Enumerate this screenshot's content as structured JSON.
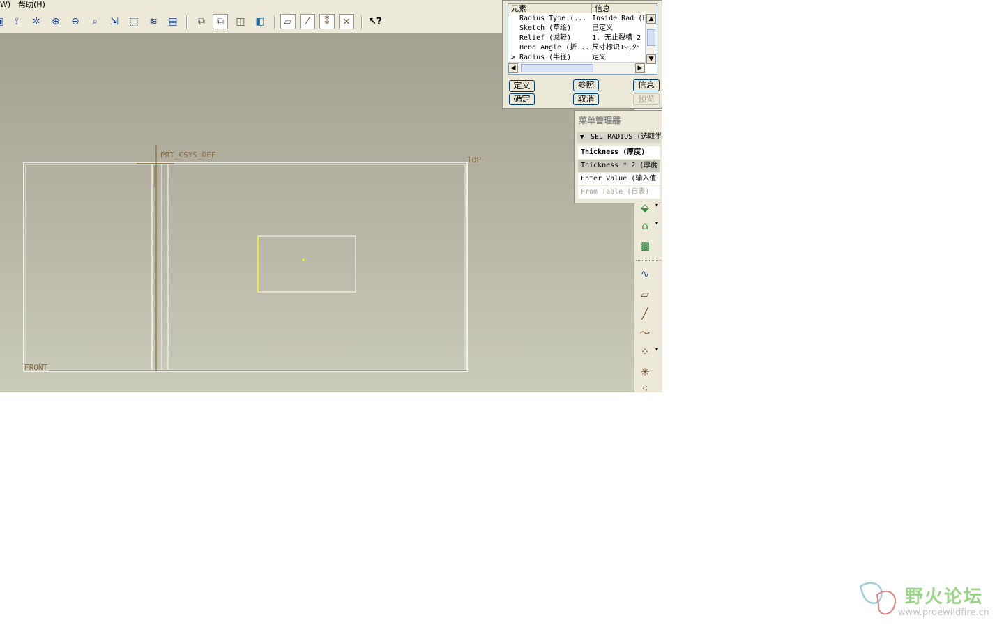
{
  "menubar": {
    "item_w_suffix": "W)",
    "help": "帮助(H)"
  },
  "toolbar": {
    "icons": [
      "repaint-icon",
      "csys-icon",
      "orient-icon",
      "zoom-in-icon",
      "zoom-out-icon",
      "refit-icon",
      "reorient-icon",
      "named-view-icon",
      "layers-icon",
      "view-manager-icon",
      "wireframe-icon",
      "hidden-line-icon",
      "no-hidden-icon",
      "shading-icon",
      "datum-planes-icon",
      "datum-axes-icon",
      "datum-points-icon",
      "coordinate-systems-icon",
      "context-help-icon"
    ]
  },
  "dialog": {
    "col_element": "元素",
    "col_info": "信息",
    "rows": [
      {
        "element": "Radius Type (...",
        "info": "Inside Rad (F"
      },
      {
        "element": "Sketch (草绘)",
        "info": "已定义"
      },
      {
        "element": "Relief (减轻)",
        "info": "1. 无止裂槽 2"
      },
      {
        "element": "Bend Angle (折...",
        "info": "尺寸标识19,外"
      },
      {
        "element": "Radius (半径)",
        "info": "定义"
      }
    ],
    "active_row_marker": ">",
    "buttons": {
      "define": "定义",
      "refs": "参照",
      "info": "信息",
      "ok": "确定",
      "cancel": "取消",
      "preview": "预览"
    }
  },
  "menu_manager": {
    "title": "菜单管理器",
    "header": "SEL RADIUS (选取半径)",
    "items": [
      {
        "label": "Thickness  (厚度)",
        "state": "bold"
      },
      {
        "label": "Thickness * 2 (厚度",
        "state": "selected"
      },
      {
        "label": "Enter Value (输入值",
        "state": "normal"
      },
      {
        "label": "From Table (自表)",
        "state": "disabled"
      }
    ]
  },
  "viewport": {
    "labels": {
      "csys": "PRT_CSYS_DEF",
      "top": "TOP",
      "front": "FRONT"
    },
    "colors": {
      "datum": "#8a6a3c",
      "sketch": "#ffff00",
      "edge": "#ffffff"
    }
  },
  "right_toolbar": {
    "icons": [
      "extrude-icon",
      "revolve-icon",
      "sweep-icon",
      "datum-curve-icon",
      "datum-plane-icon",
      "datum-axis-icon",
      "sketched-curve-icon",
      "datum-point-icon",
      "csys-create-icon",
      "point-offset-icon"
    ]
  },
  "watermark": {
    "name": "野火论坛",
    "url": "www.proewildfire.cn"
  }
}
